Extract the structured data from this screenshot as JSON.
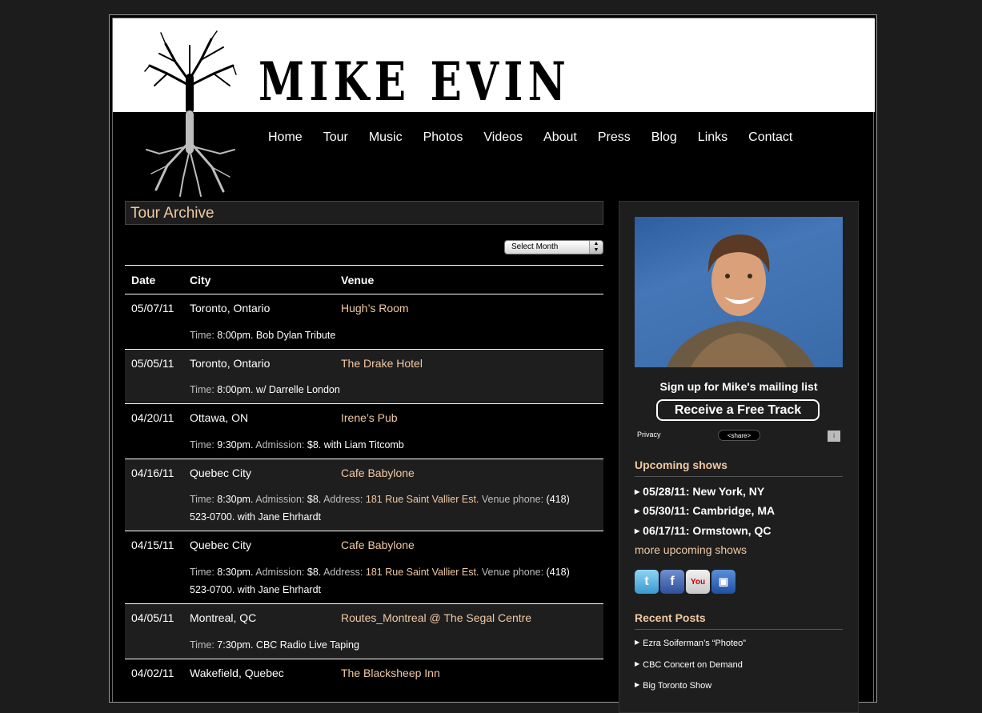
{
  "site": {
    "title": "MIKE EVIN"
  },
  "nav": [
    "Home",
    "Tour",
    "Music",
    "Photos",
    "Videos",
    "About",
    "Press",
    "Blog",
    "Links",
    "Contact"
  ],
  "page": {
    "title": "Tour Archive",
    "month_select": "Select Month"
  },
  "table": {
    "headers": {
      "date": "Date",
      "city": "City",
      "venue": "Venue"
    },
    "rows": [
      {
        "date": "05/07/11",
        "city": "Toronto, Ontario",
        "venue": "Hugh’s Room",
        "time_label": "Time:",
        "time": "8:00pm. Bob Dylan Tribute"
      },
      {
        "date": "05/05/11",
        "city": "Toronto, Ontario",
        "venue": "The Drake Hotel",
        "time_label": "Time:",
        "time": "8:00pm. w/ Darrelle London"
      },
      {
        "date": "04/20/11",
        "city": "Ottawa, ON",
        "venue": "Irene’s Pub",
        "time_label": "Time:",
        "time": "9:30pm.",
        "admission_label": "Admission:",
        "admission": "$8. with Liam Titcomb"
      },
      {
        "date": "04/16/11",
        "city": "Quebec City",
        "venue": "Cafe Babylone",
        "time_label": "Time:",
        "time": "8:30pm.",
        "admission_label": "Admission:",
        "admission": "$8.",
        "address_label": "Address:",
        "address": "181 Rue Saint Vallier Est.",
        "phone_label": "Venue phone:",
        "phone": "(418) 523-0700. with Jane Ehrhardt"
      },
      {
        "date": "04/15/11",
        "city": "Quebec City",
        "venue": "Cafe Babylone",
        "time_label": "Time:",
        "time": "8:30pm.",
        "admission_label": "Admission:",
        "admission": "$8.",
        "address_label": "Address:",
        "address": "181 Rue Saint Vallier Est.",
        "phone_label": "Venue phone:",
        "phone": "(418) 523-0700. with Jane Ehrhardt"
      },
      {
        "date": "04/05/11",
        "city": "Montreal, QC",
        "venue": "Routes_Montreal @ The Segal Centre",
        "time_label": "Time:",
        "time": "7:30pm. CBC Radio Live Taping"
      },
      {
        "date": "04/02/11",
        "city": "Wakefield, Quebec",
        "venue": "The Blacksheep Inn"
      }
    ]
  },
  "sidebar": {
    "signup": "Sign up for Mike's mailing list",
    "free_track": "Receive a Free Track",
    "privacy": "Privacy",
    "share": "<share>",
    "info": "i",
    "upcoming_title": "Upcoming shows",
    "upcoming": [
      "05/28/11: New York, NY",
      "05/30/11: Cambridge, MA",
      "06/17/11: Ormstown, QC"
    ],
    "more_shows": "more upcoming shows",
    "recent_title": "Recent Posts",
    "posts": [
      "Ezra Soiferman’s “Photeo”",
      "CBC Concert on Demand",
      "Big Toronto Show"
    ]
  },
  "colors": {
    "accent": "#f1c9a3",
    "background": "#000000",
    "panel": "#1e1e1e"
  },
  "icons": [
    "twitter-icon",
    "facebook-icon",
    "youtube-icon",
    "myspace-icon"
  ]
}
